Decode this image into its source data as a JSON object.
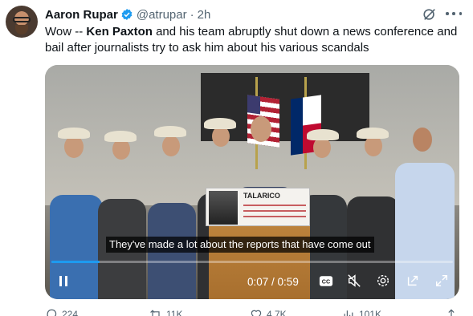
{
  "author": {
    "name": "Aaron Rupar",
    "handle": "@atrupar",
    "separator": "·",
    "time": "2h",
    "verified": true
  },
  "icons": {
    "verified": "verified-badge-icon",
    "grok": "grok-icon",
    "more": "more-icon"
  },
  "tweet": {
    "text_before": "Wow -- ",
    "text_bold": "Ken Paxton",
    "text_after": " and his team abruptly shut down a news conference and bail after journalists try to ask him about his various scandals"
  },
  "video": {
    "caption": "They've made a lot about the reports that have come out",
    "current_time": "0:07",
    "time_separator": " / ",
    "duration": "0:59",
    "progress": 0.12,
    "sign_title": "TALARICO",
    "controls": [
      "pause-icon",
      "cc-icon",
      "mute-icon",
      "settings-icon",
      "pip-icon",
      "fullscreen-icon"
    ],
    "cc_label": "CC"
  },
  "actions": {
    "reply_count": "224",
    "repost_count": "11K",
    "like_count": "4.7K",
    "views_count": "101K"
  },
  "colors": {
    "accent": "#1d9bf0",
    "text": "#0f1419",
    "secondary": "#536471"
  }
}
